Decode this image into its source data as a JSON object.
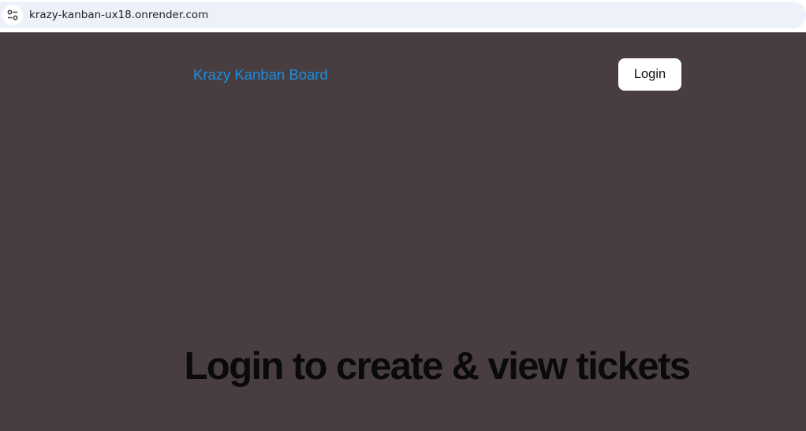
{
  "browser": {
    "url": "krazy-kanban-ux18.onrender.com",
    "site_info_icon": "tune-icon"
  },
  "header": {
    "brand": "Krazy Kanban Board",
    "login_label": "Login"
  },
  "main": {
    "heading": "Login to create & view tickets"
  },
  "colors": {
    "page_background": "#483e3f",
    "brand_link": "#1a8de4",
    "button_background": "#ffffff",
    "heading_text": "#0a0a0a"
  }
}
